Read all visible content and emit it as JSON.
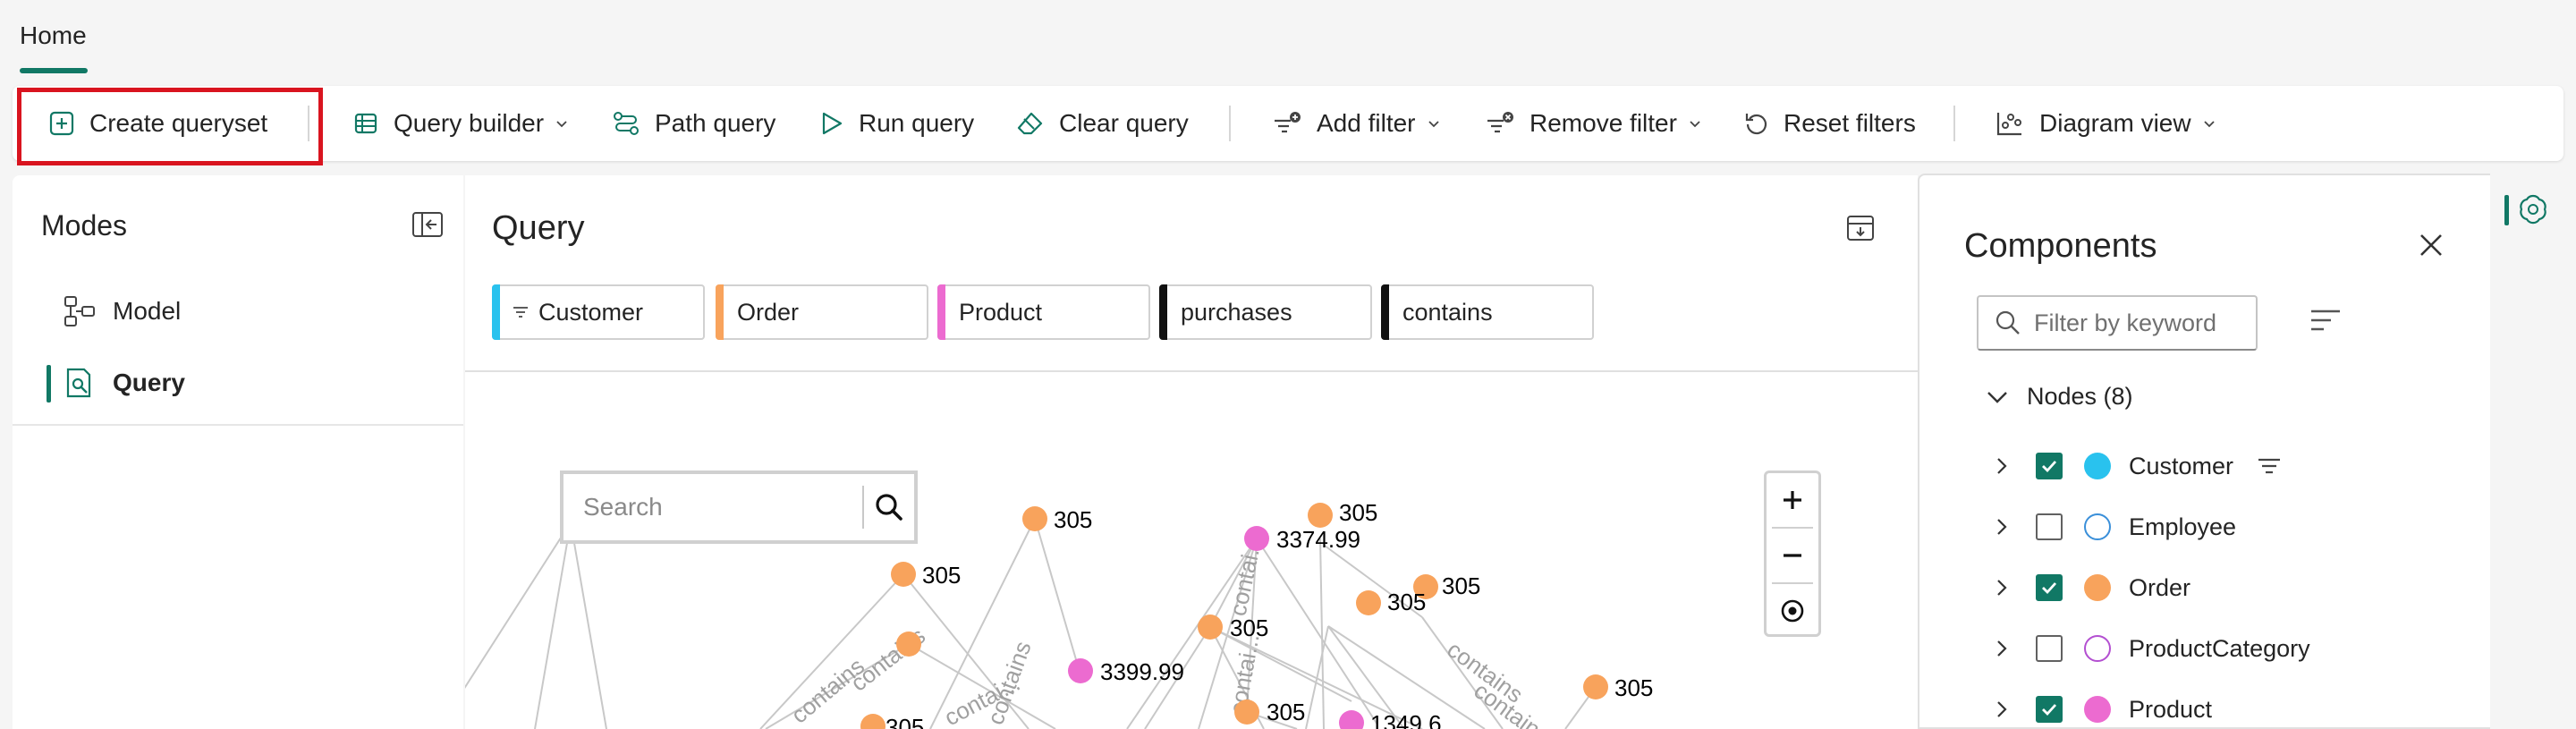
{
  "tabs": {
    "home": "Home"
  },
  "toolbar": {
    "create_queryset": "Create queryset",
    "query_builder": "Query builder",
    "path_query": "Path query",
    "run_query": "Run query",
    "clear_query": "Clear query",
    "add_filter": "Add filter",
    "remove_filter": "Remove filter",
    "reset_filters": "Reset filters",
    "diagram_view": "Diagram view"
  },
  "modes": {
    "title": "Modes",
    "items": [
      {
        "label": "Model",
        "icon": "model-icon",
        "active": false
      },
      {
        "label": "Query",
        "icon": "query-icon",
        "active": true
      }
    ]
  },
  "query": {
    "title": "Query",
    "pills": [
      {
        "label": "Customer",
        "color": "#29c2ee",
        "has_filter": true
      },
      {
        "label": "Order",
        "color": "#f8a35c",
        "has_filter": false
      },
      {
        "label": "Product",
        "color": "#ec6bd0",
        "has_filter": false
      },
      {
        "label": "purchases",
        "color": "#111111",
        "has_filter": false
      },
      {
        "label": "contains",
        "color": "#111111",
        "has_filter": false
      }
    ],
    "search_placeholder": "Search",
    "graph_labels": [
      "305",
      "305",
      "3399.99",
      "305",
      "305",
      "3374.99",
      "305",
      "305",
      "305",
      "305",
      "1349.6",
      "305"
    ],
    "edge_labels": [
      "contains",
      "contains",
      "contains",
      "contains",
      "contains",
      "contai...",
      "contai...",
      "contai..."
    ],
    "zoom": {
      "in": "+",
      "out": "−"
    }
  },
  "components": {
    "title": "Components",
    "filter_placeholder": "Filter by keyword",
    "nodes_header": "Nodes (8)",
    "nodes": [
      {
        "label": "Customer",
        "checked": true,
        "color": "#29c2ee",
        "filled": true,
        "has_filter": true
      },
      {
        "label": "Employee",
        "checked": false,
        "color": "#3a8fd9",
        "filled": false,
        "has_filter": false
      },
      {
        "label": "Order",
        "checked": true,
        "color": "#f8a35c",
        "filled": true,
        "has_filter": false
      },
      {
        "label": "ProductCategory",
        "checked": false,
        "color": "#b34fd1",
        "filled": false,
        "has_filter": false
      },
      {
        "label": "Product",
        "checked": true,
        "color": "#ec6bd0",
        "filled": true,
        "has_filter": false
      }
    ]
  },
  "colors": {
    "accent": "#117865",
    "highlight": "#d9141f",
    "order_node": "#f8a35c",
    "product_node": "#ec6bd0"
  }
}
